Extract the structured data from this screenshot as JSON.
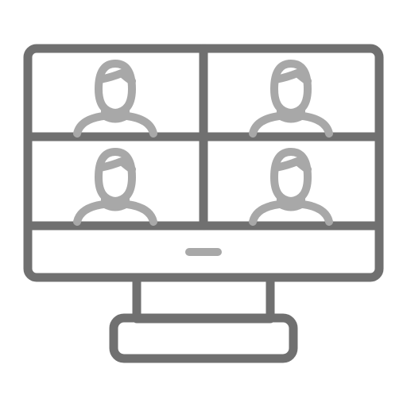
{
  "icon": {
    "name": "video-conference-monitor-icon",
    "participant_count": 4,
    "participants": [
      {
        "name": "participant-avatar-icon"
      },
      {
        "name": "participant-avatar-icon"
      },
      {
        "name": "participant-avatar-icon"
      },
      {
        "name": "participant-avatar-icon"
      }
    ]
  },
  "colors": {
    "monitor_stroke": "#707070",
    "avatar_stroke": "#a8a8a8",
    "background": "#ffffff"
  }
}
